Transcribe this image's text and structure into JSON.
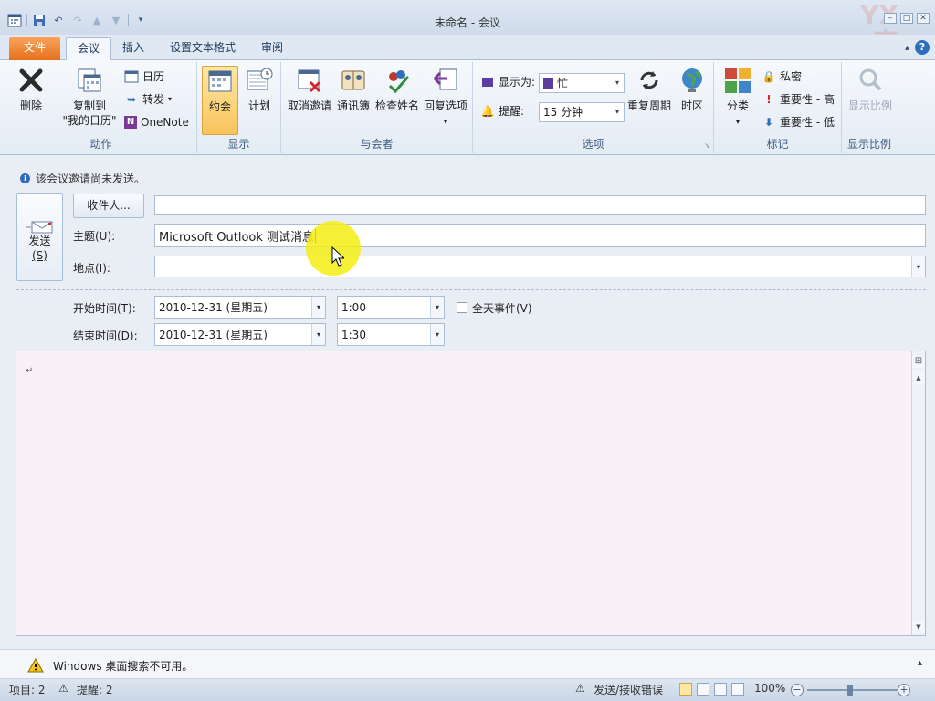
{
  "window": {
    "title": "未命名 - 会议"
  },
  "tabs": [
    {
      "label": "文件"
    },
    {
      "label": "会议"
    },
    {
      "label": "插入"
    },
    {
      "label": "设置文本格式"
    },
    {
      "label": "审阅"
    }
  ],
  "ribbon": {
    "actions": {
      "label": "动作",
      "delete": "删除",
      "copy_line1": "复制到",
      "copy_line2": "\"我的日历\"",
      "calendar": "日历",
      "forward": "转发",
      "onenote": "OneNote"
    },
    "show": {
      "label": "显示",
      "appointment": "约会",
      "plan": "计划"
    },
    "attendees": {
      "label": "与会者",
      "cancel": "取消邀请",
      "addressbook": "通讯簿",
      "checknames": "检查姓名",
      "response": "回复选项"
    },
    "options": {
      "label": "选项",
      "showas_label": "显示为:",
      "showas_value": "忙",
      "reminder_label": "提醒:",
      "reminder_value": "15 分钟",
      "recurrence": "重复周期",
      "timezone": "时区"
    },
    "tags": {
      "label": "标记",
      "categorize": "分类",
      "private": "私密",
      "high": "重要性 - 高",
      "low": "重要性 - 低"
    },
    "zoom": {
      "label": "显示比例",
      "button": "显示比例"
    }
  },
  "form": {
    "info": "该会议邀请尚未发送。",
    "send_label": "发送",
    "send_shortcut": "(S)",
    "to_button": "收件人...",
    "to_value": "",
    "subject_label": "主题(U):",
    "subject_value": "Microsoft Outlook 测试消息",
    "location_label": "地点(I):",
    "location_value": "",
    "start_label": "开始时间(T):",
    "start_date": "2010-12-31 (星期五)",
    "start_time": "1:00",
    "end_label": "结束时间(D):",
    "end_date": "2010-12-31 (星期五)",
    "end_time": "1:30",
    "allday_label": "全天事件(V)",
    "allday_checked": false,
    "body_mark": "↵"
  },
  "infobar": {
    "text": "Windows 桌面搜索不可用。"
  },
  "status": {
    "items": "项目: 2",
    "reminders": "提醒: 2",
    "error": "发送/接收错误",
    "zoom": "100%"
  }
}
